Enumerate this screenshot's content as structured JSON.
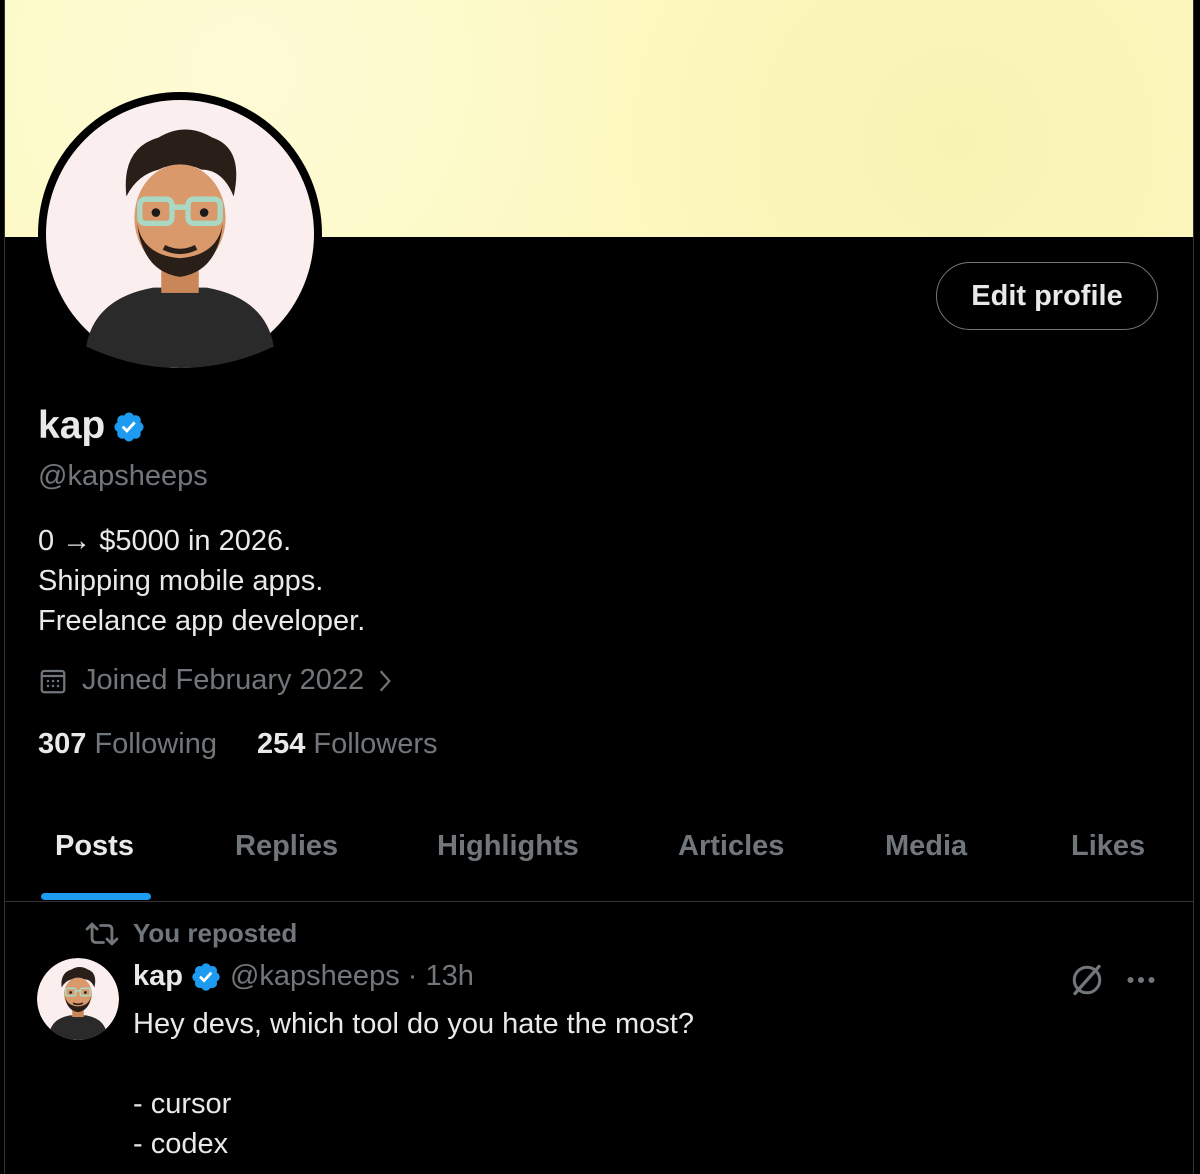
{
  "profile": {
    "name": "kap",
    "handle": "@kapsheeps",
    "bio": [
      "0 → $5000 in 2026.",
      "Shipping mobile apps.",
      "Freelance app developer."
    ],
    "joined": "Joined February 2022",
    "following_count": "307",
    "following_label": "Following",
    "followers_count": "254",
    "followers_label": "Followers",
    "edit_button": "Edit profile"
  },
  "tabs": [
    "Posts",
    "Replies",
    "Highlights",
    "Articles",
    "Media",
    "Likes"
  ],
  "active_tab": "Posts",
  "post": {
    "repost_label": "You reposted",
    "name": "kap",
    "handle": "@kapsheeps",
    "time": "13h",
    "text": "Hey devs, which tool do you hate the most?\n\n- cursor\n- codex"
  },
  "icons": {
    "verified": "verified-badge-icon",
    "calendar": "calendar-icon",
    "chevron": "chevron-right-icon",
    "repost": "repost-icon",
    "grok": "grok-icon",
    "more": "more-icon"
  },
  "colors": {
    "accent": "#1d9bf0",
    "banner": "#fdf9c2",
    "text": "#e7e9ea",
    "muted": "#71767b",
    "background": "#000000"
  }
}
